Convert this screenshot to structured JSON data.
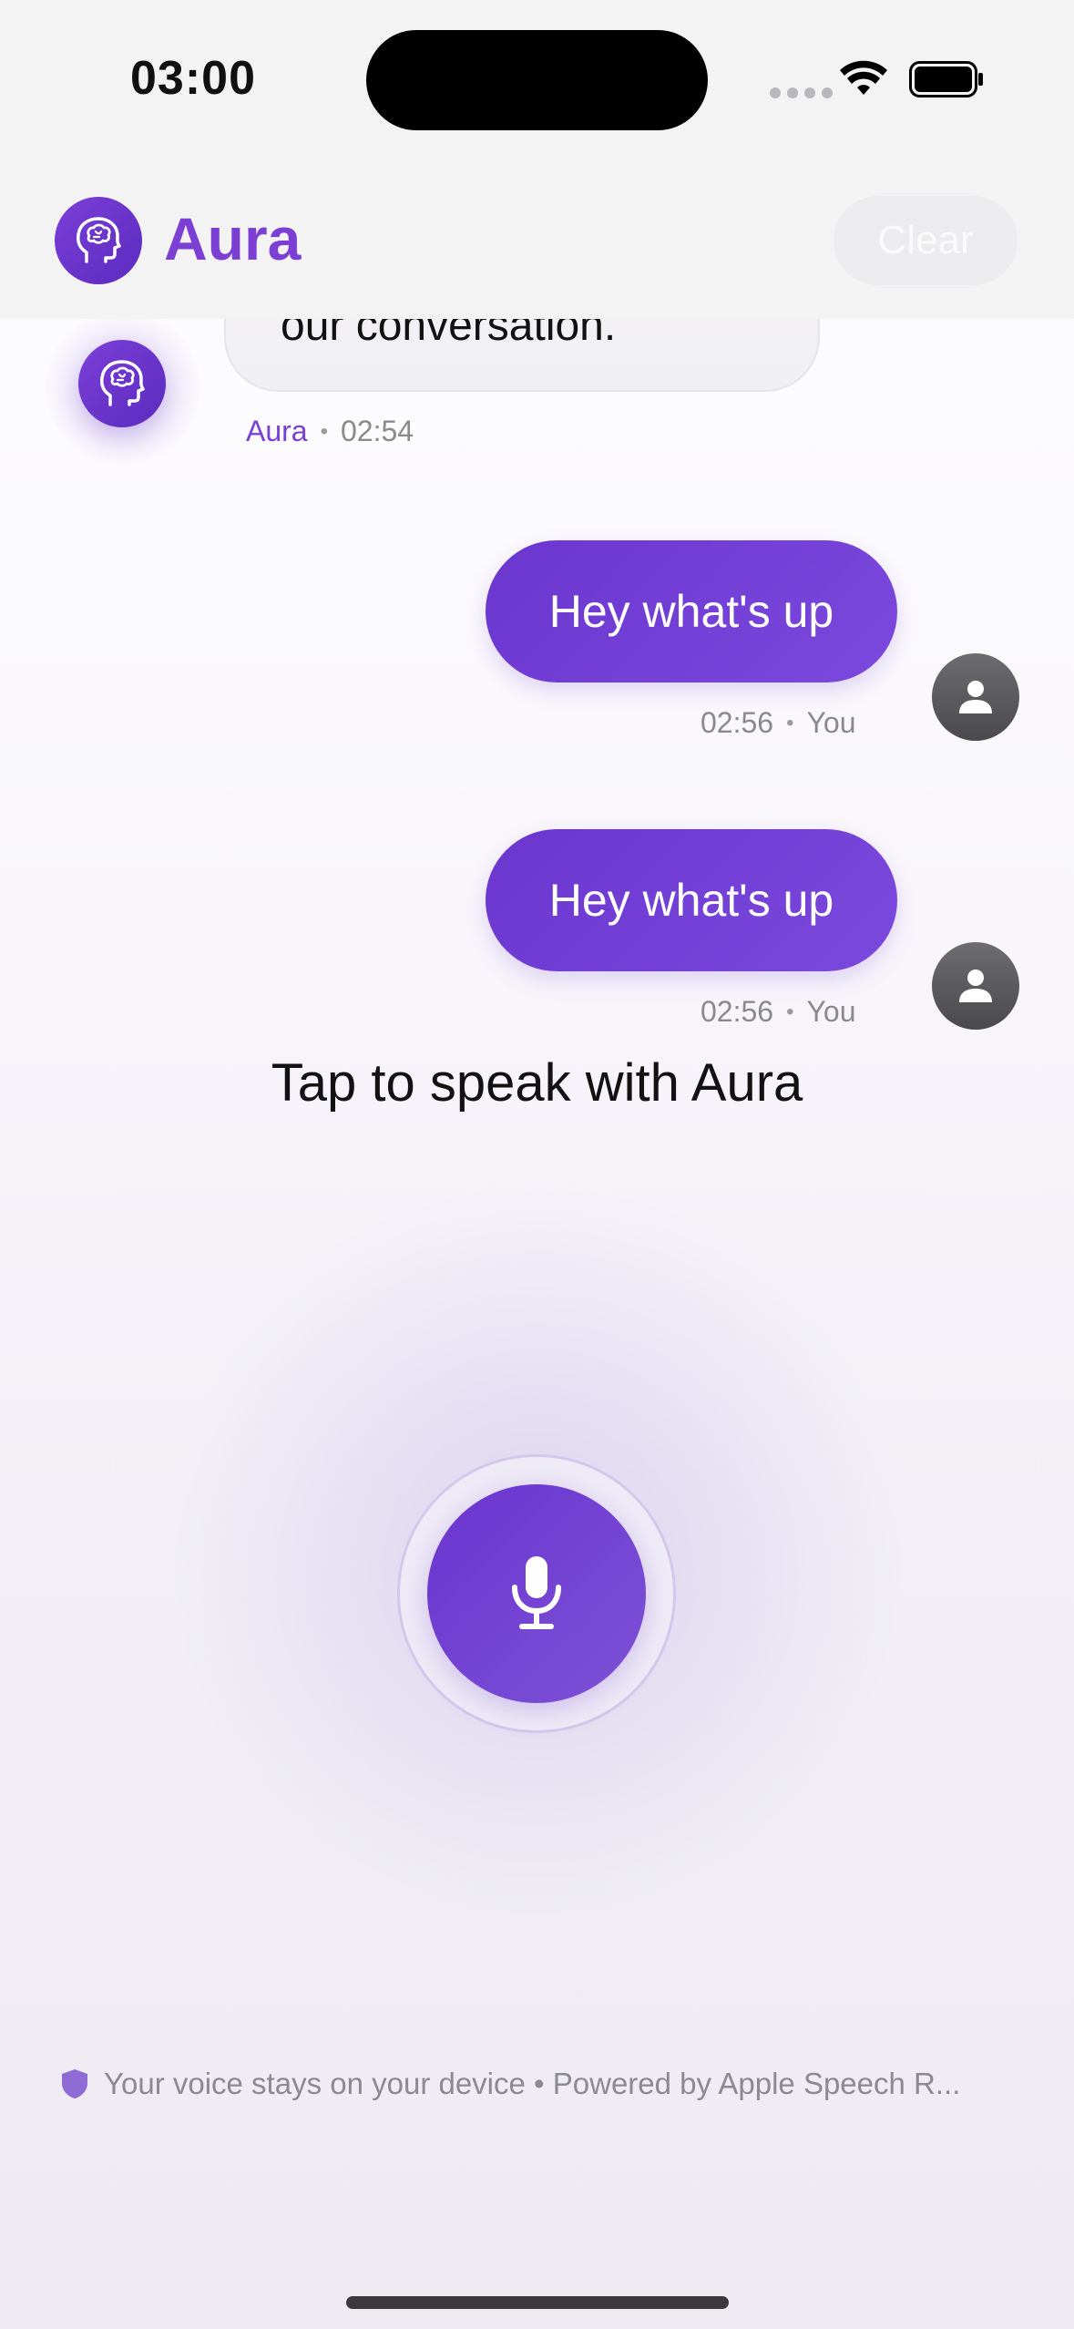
{
  "status_bar": {
    "time": "03:00"
  },
  "header": {
    "app_name": "Aura",
    "clear_label": "Clear"
  },
  "messages": [
    {
      "sender": "Aura",
      "text": "our conversation.",
      "time": "02:54"
    },
    {
      "sender": "You",
      "text": "Hey what's up",
      "time": "02:56"
    },
    {
      "sender": "You",
      "text": "Hey what's up",
      "time": "02:56"
    }
  ],
  "prompt": "Tap to speak with Aura",
  "footer": {
    "note": "Your voice stays on your device • Powered by Apple Speech R..."
  },
  "colors": {
    "accent": "#7b3fd4",
    "bubble_user": "#6a36cf",
    "avatar_user": "#5a5a5d"
  },
  "icons": {
    "app_logo": "brain-head-icon",
    "user_avatar": "person-icon",
    "mic": "microphone-icon",
    "footer": "shield-icon"
  }
}
